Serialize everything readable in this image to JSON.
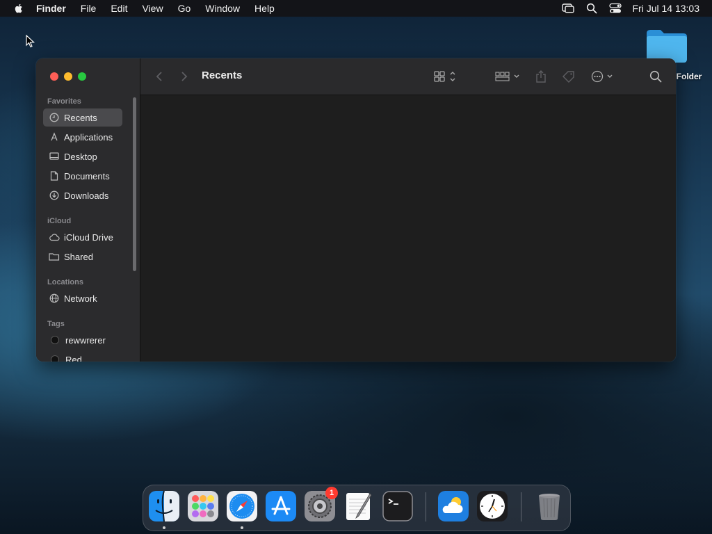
{
  "menubar": {
    "app_name": "Finder",
    "items": [
      "File",
      "Edit",
      "View",
      "Go",
      "Window",
      "Help"
    ],
    "clock": "Fri Jul 14  13:03",
    "icons": [
      "apple-icon",
      "screen-mirroring-icon",
      "spotlight-search-icon",
      "control-center-icon"
    ]
  },
  "desktop": {
    "folder_label": "New Folder"
  },
  "finder": {
    "title": "Recents",
    "sidebar": {
      "favorites_title": "Favorites",
      "favorites": [
        {
          "label": "Recents",
          "icon": "clock-icon"
        },
        {
          "label": "Applications",
          "icon": "applications-icon"
        },
        {
          "label": "Desktop",
          "icon": "desktop-icon"
        },
        {
          "label": "Documents",
          "icon": "document-icon"
        },
        {
          "label": "Downloads",
          "icon": "download-icon"
        }
      ],
      "icloud_title": "iCloud",
      "icloud": [
        {
          "label": "iCloud Drive",
          "icon": "cloud-icon"
        },
        {
          "label": "Shared",
          "icon": "shared-folder-icon"
        }
      ],
      "locations_title": "Locations",
      "locations": [
        {
          "label": "Network",
          "icon": "globe-icon"
        }
      ],
      "tags_title": "Tags",
      "tags": [
        {
          "label": "rewwrerer"
        },
        {
          "label": "Red"
        }
      ]
    }
  },
  "dock": {
    "apps": [
      "Finder",
      "Launchpad",
      "Safari",
      "App Store",
      "System Settings",
      "TextEdit",
      "Terminal",
      "Weather",
      "Clock",
      "Trash"
    ],
    "settings_badge": "1"
  },
  "colors": {
    "close": "#ff5f57",
    "minimize": "#febc2e",
    "maximize": "#28c840",
    "folder": "#3aa8e8"
  }
}
